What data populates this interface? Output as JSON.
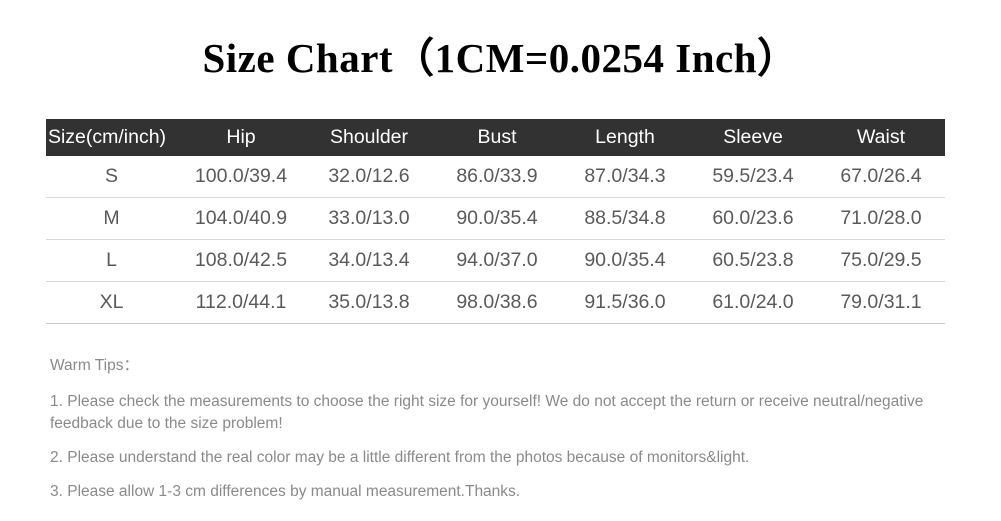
{
  "title": "Size Chart（1CM=0.0254 Inch）",
  "table": {
    "headers": [
      "Size(cm/inch)",
      "Hip",
      "Shoulder",
      "Bust",
      "Length",
      "Sleeve",
      "Waist"
    ],
    "rows": [
      [
        "S",
        "100.0/39.4",
        "32.0/12.6",
        "86.0/33.9",
        "87.0/34.3",
        "59.5/23.4",
        "67.0/26.4"
      ],
      [
        "M",
        "104.0/40.9",
        "33.0/13.0",
        "90.0/35.4",
        "88.5/34.8",
        "60.0/23.6",
        "71.0/28.0"
      ],
      [
        "L",
        "108.0/42.5",
        "34.0/13.4",
        "94.0/37.0",
        "90.0/35.4",
        "60.5/23.8",
        "75.0/29.5"
      ],
      [
        "XL",
        "112.0/44.1",
        "35.0/13.8",
        "98.0/38.6",
        "91.5/36.0",
        "61.0/24.0",
        "79.0/31.1"
      ]
    ]
  },
  "tips": {
    "heading": "Warm Tips：",
    "items": [
      "1. Please check the measurements to choose the right size for yourself! We do not accept the return or receive neutral/negative feedback due to the size problem!",
      "2. Please understand the real color may be a little different from the photos because of monitors&light.",
      "3. Please allow 1-3 cm differences by manual measurement.Thanks."
    ]
  },
  "colors": {
    "header_bg": "#323232",
    "header_text": "#ffffff",
    "cell_text": "#5a5a5a",
    "tips_text": "#8a8a8a",
    "row_divider": "#d8d8d8",
    "page_bg": "#ffffff"
  }
}
